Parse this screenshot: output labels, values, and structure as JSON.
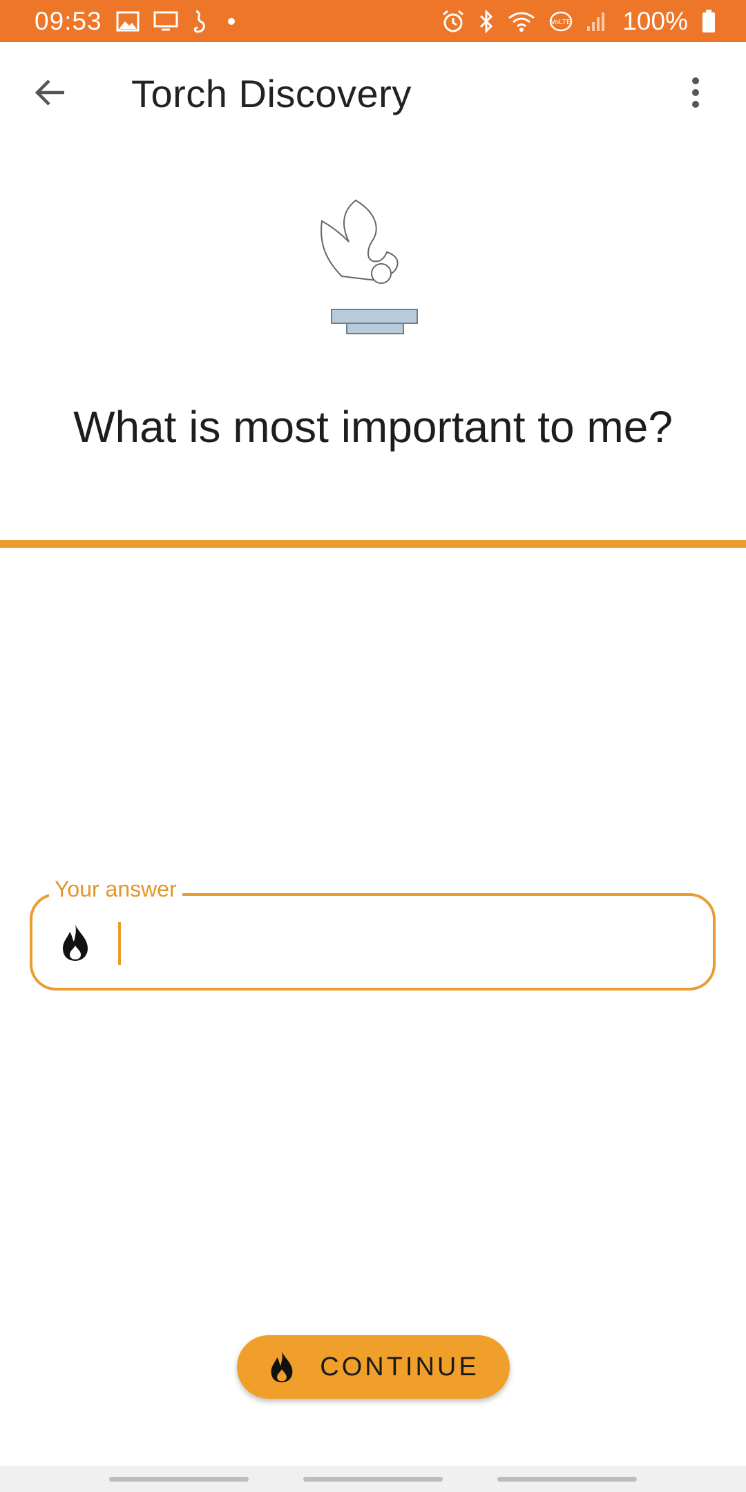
{
  "status_bar": {
    "time": "09:53",
    "battery": "100%",
    "left_icons": [
      "image-icon",
      "cast-icon",
      "samsung-health-icon",
      "notification-dot-icon"
    ],
    "right_icons": [
      "alarm-icon",
      "bluetooth-icon",
      "wifi-icon",
      "volte-icon",
      "signal-icon",
      "battery-icon"
    ]
  },
  "app_bar": {
    "title": "Torch Discovery",
    "back_icon": "arrow-left-icon",
    "menu_icon": "more-vertical-icon"
  },
  "header": {
    "logo_icon": "torch-logo-icon",
    "question": "What is most important to me?"
  },
  "answer": {
    "label": "Your answer",
    "value": "",
    "icon": "flame-icon"
  },
  "continue_button": {
    "label": "CONTINUE",
    "icon": "flame-icon"
  },
  "colors": {
    "status_bar": "#ee7628",
    "accent": "#eb9c31",
    "button": "#f0a02a",
    "text": "#222222"
  }
}
